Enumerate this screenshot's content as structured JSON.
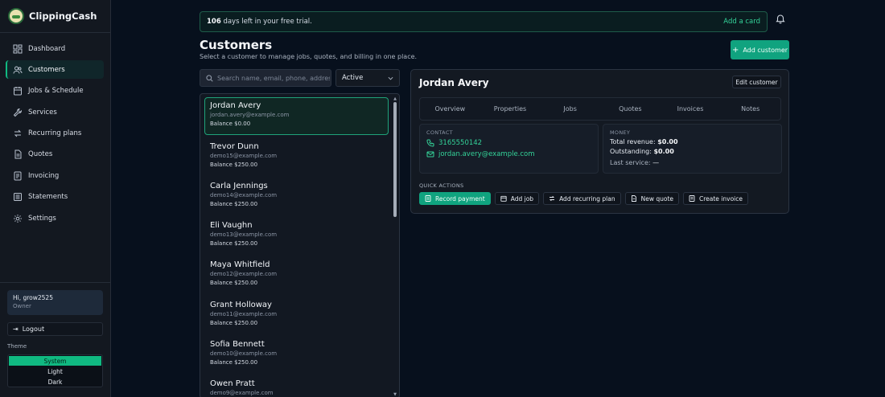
{
  "app": {
    "name": "ClippingCash"
  },
  "colors": {
    "accent": "#10b981",
    "background": "#07101d",
    "sidebar": "#131820"
  },
  "sidebar": {
    "items": [
      {
        "label": "Dashboard",
        "icon": "grid-icon"
      },
      {
        "label": "Customers",
        "icon": "users-icon",
        "active": true
      },
      {
        "label": "Jobs & Schedule",
        "icon": "calendar-icon"
      },
      {
        "label": "Services",
        "icon": "wrench-icon"
      },
      {
        "label": "Recurring plans",
        "icon": "repeat-icon"
      },
      {
        "label": "Quotes",
        "icon": "document-icon"
      },
      {
        "label": "Invoicing",
        "icon": "invoice-icon"
      },
      {
        "label": "Statements",
        "icon": "statement-icon"
      },
      {
        "label": "Settings",
        "icon": "gear-icon"
      }
    ],
    "user": {
      "greeting": "Hi, grow2525",
      "role": "Owner"
    },
    "logout_label": "Logout",
    "theme": {
      "label": "Theme",
      "options": [
        "System",
        "Light",
        "Dark"
      ],
      "selected": "System"
    }
  },
  "trial": {
    "days": "106",
    "text": "days left in your free trial.",
    "action": "Add a card"
  },
  "header": {
    "title": "Customers",
    "subtitle": "Select a customer to manage jobs, quotes, and billing in one place.",
    "add_button": "Add customer"
  },
  "filters": {
    "search_placeholder": "Search name, email, phone, address",
    "status_value": "Active"
  },
  "customers": [
    {
      "name": "Jordan Avery",
      "email": "jordan.avery@example.com",
      "balance": "Balance $0.00",
      "selected": true
    },
    {
      "name": "Trevor Dunn",
      "email": "demo15@example.com",
      "balance": "Balance $250.00"
    },
    {
      "name": "Carla Jennings",
      "email": "demo14@example.com",
      "balance": "Balance $250.00"
    },
    {
      "name": "Eli Vaughn",
      "email": "demo13@example.com",
      "balance": "Balance $250.00"
    },
    {
      "name": "Maya Whitfield",
      "email": "demo12@example.com",
      "balance": "Balance $250.00"
    },
    {
      "name": "Grant Holloway",
      "email": "demo11@example.com",
      "balance": "Balance $250.00"
    },
    {
      "name": "Sofia Bennett",
      "email": "demo10@example.com",
      "balance": "Balance $250.00"
    },
    {
      "name": "Owen Pratt",
      "email": "demo9@example.com",
      "balance": ""
    }
  ],
  "detail": {
    "name": "Jordan Avery",
    "edit_label": "Edit customer",
    "tabs": [
      "Overview",
      "Properties",
      "Jobs",
      "Quotes",
      "Invoices",
      "Notes"
    ],
    "contact": {
      "label": "CONTACT",
      "phone": "3165550142",
      "email": "jordan.avery@example.com"
    },
    "money": {
      "label": "MONEY",
      "total_revenue_label": "Total revenue:",
      "total_revenue": "$0.00",
      "outstanding_label": "Outstanding:",
      "outstanding": "$0.00",
      "last_service_label": "Last service:",
      "last_service": "—"
    },
    "quick_actions": {
      "label": "QUICK ACTIONS",
      "buttons": [
        "Record payment",
        "Add job",
        "Add recurring plan",
        "New quote",
        "Create invoice"
      ]
    }
  }
}
